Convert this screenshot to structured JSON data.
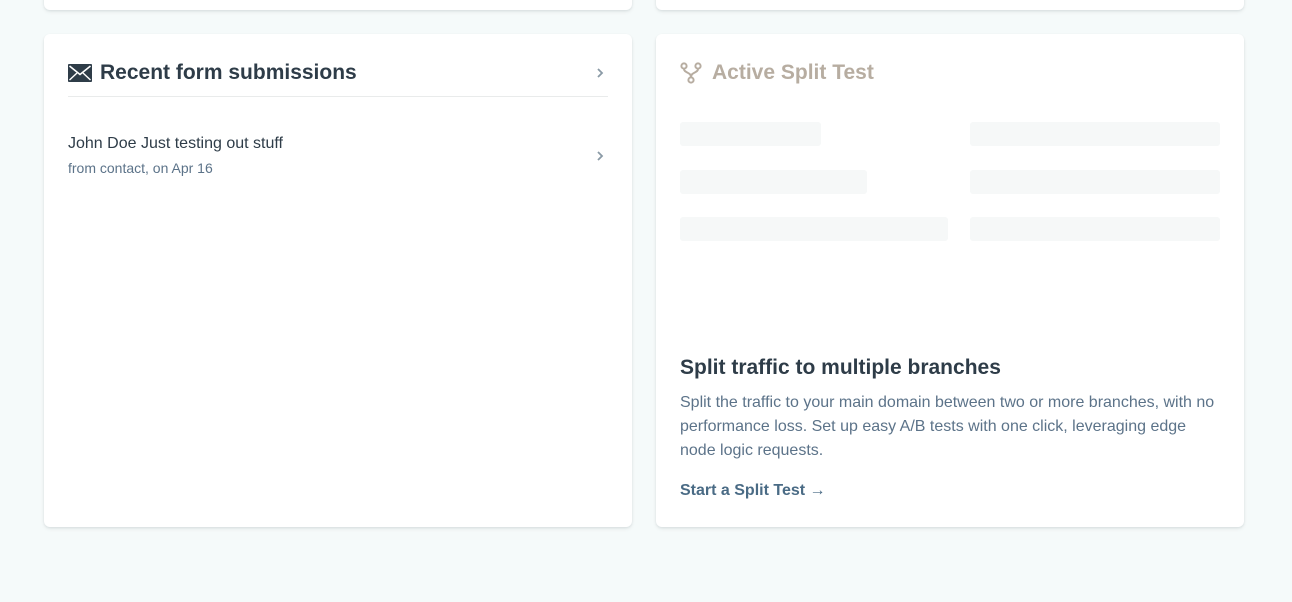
{
  "forms_card": {
    "title": "Recent form submissions",
    "icon": "mail-icon",
    "submissions": [
      {
        "text": "John Doe Just testing out stuff",
        "meta": "from contact, on Apr 16"
      }
    ]
  },
  "split_card": {
    "title": "Active Split Test",
    "icon": "split-fork-icon",
    "promo_title": "Split traffic to multiple branches",
    "promo_text": "Split the traffic to your main domain between two or more branches, with no performance loss. Set up easy A/B tests with one click, leveraging edge node logic requests.",
    "cta_label": "Start a Split Test →"
  },
  "colors": {
    "background": "#f5fafa",
    "card": "#ffffff",
    "heading": "#2e3c48",
    "muted": "#5c7389",
    "disabled_title": "#b7ada1",
    "link": "#4a6b85"
  }
}
